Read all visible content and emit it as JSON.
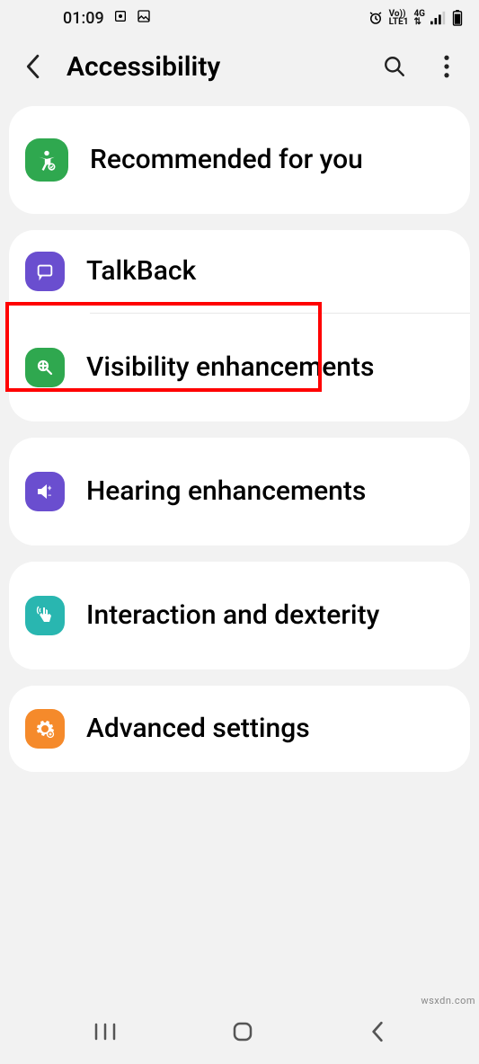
{
  "status": {
    "time": "01:09",
    "net1": "Vo))",
    "net2": "LTE1",
    "sig": "4G"
  },
  "header": {
    "title": "Accessibility"
  },
  "sections": [
    {
      "items": [
        {
          "label": "Recommended for you",
          "icon": "accessibility-icon",
          "color": "c-green"
        }
      ]
    },
    {
      "items": [
        {
          "label": "TalkBack",
          "icon": "talkback-icon",
          "color": "c-purple",
          "highlight": true
        },
        {
          "label": "Visibility enhancements",
          "icon": "visibility-icon",
          "color": "c-green2"
        }
      ]
    },
    {
      "items": [
        {
          "label": "Hearing enhancements",
          "icon": "hearing-icon",
          "color": "c-purple"
        }
      ]
    },
    {
      "items": [
        {
          "label": "Interaction and dexterity",
          "icon": "interaction-icon",
          "color": "c-teal"
        }
      ]
    },
    {
      "items": [
        {
          "label": "Advanced settings",
          "icon": "advanced-icon",
          "color": "c-orange"
        }
      ]
    }
  ],
  "watermark": "wsxdn.com"
}
